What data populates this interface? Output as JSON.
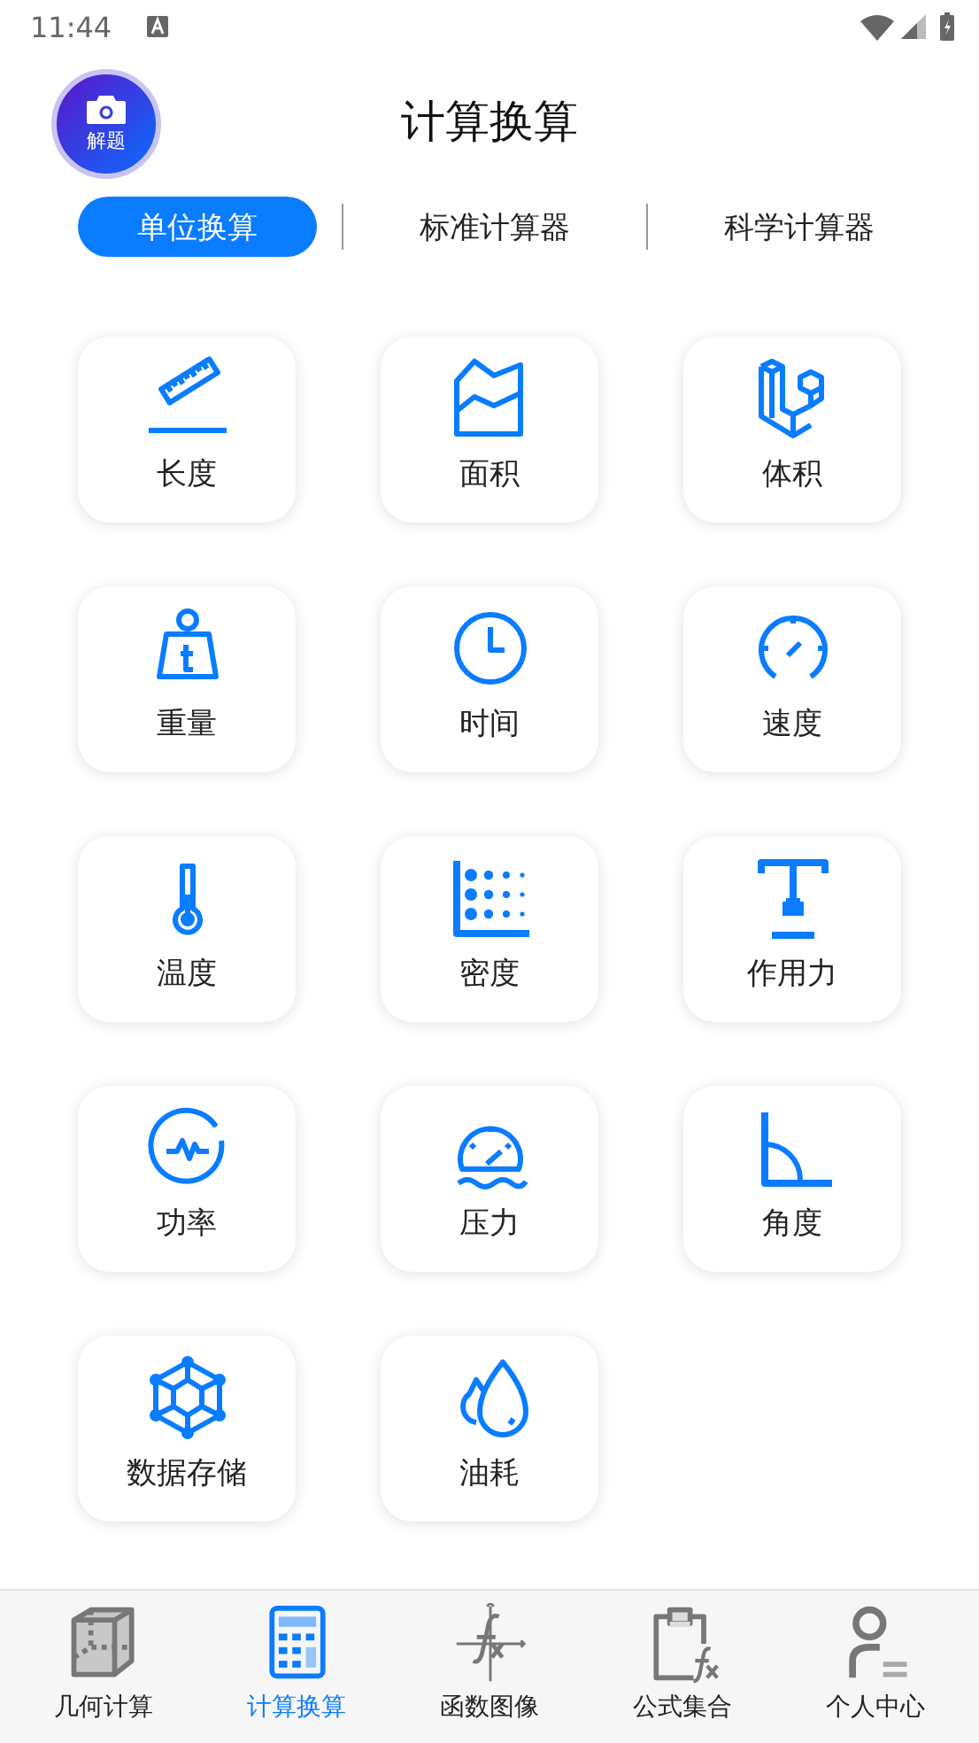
{
  "status_bar": {
    "time": "11:44"
  },
  "header": {
    "badge_label": "解题",
    "title": "计算换算"
  },
  "tabs": [
    {
      "label": "单位换算",
      "selected": true
    },
    {
      "label": "标准计算器",
      "selected": false
    },
    {
      "label": "科学计算器",
      "selected": false
    }
  ],
  "categories": [
    {
      "label": "长度"
    },
    {
      "label": "面积"
    },
    {
      "label": "体积"
    },
    {
      "label": "重量"
    },
    {
      "label": "时间"
    },
    {
      "label": "速度"
    },
    {
      "label": "温度"
    },
    {
      "label": "密度"
    },
    {
      "label": "作用力"
    },
    {
      "label": "功率"
    },
    {
      "label": "压力"
    },
    {
      "label": "角度"
    },
    {
      "label": "数据存储"
    },
    {
      "label": "油耗"
    }
  ],
  "bottom_nav": [
    {
      "label": "几何计算",
      "selected": false
    },
    {
      "label": "计算换算",
      "selected": true
    },
    {
      "label": "函数图像",
      "selected": false
    },
    {
      "label": "公式集合",
      "selected": false
    },
    {
      "label": "个人中心",
      "selected": false
    }
  ]
}
